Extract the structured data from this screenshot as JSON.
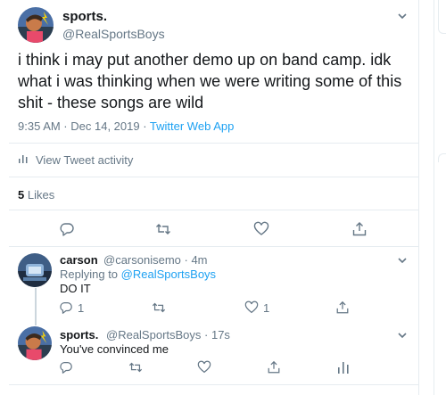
{
  "main_tweet": {
    "name": "sports.",
    "handle": "@RealSportsBoys",
    "text": "i think i may put another demo up on band camp. idk what i was thinking when we were writing some of this shit - these songs are wild",
    "time": "9:35 AM · Dec 14, 2019 · ",
    "app": "Twitter Web App",
    "activity_label": "View Tweet activity",
    "likes_count": "5",
    "likes_label": " Likes"
  },
  "reply1": {
    "name": "carson",
    "handle": "@carsonisemo · 4m",
    "replying_prefix": "Replying to ",
    "replying_handle": "@RealSportsBoys",
    "text": "DO IT",
    "reply_count": "1",
    "like_count": "1"
  },
  "reply2": {
    "name": "sports.",
    "handle": "@RealSportsBoys · 17s",
    "text": "You've convinced me"
  },
  "colors": {
    "link": "#1da1f2",
    "muted": "#657786",
    "text": "#14171a",
    "border": "#e6ecf0"
  },
  "icons": [
    "reply-icon",
    "retweet-icon",
    "like-icon",
    "share-icon",
    "analytics-icon",
    "chevron-down-icon"
  ]
}
